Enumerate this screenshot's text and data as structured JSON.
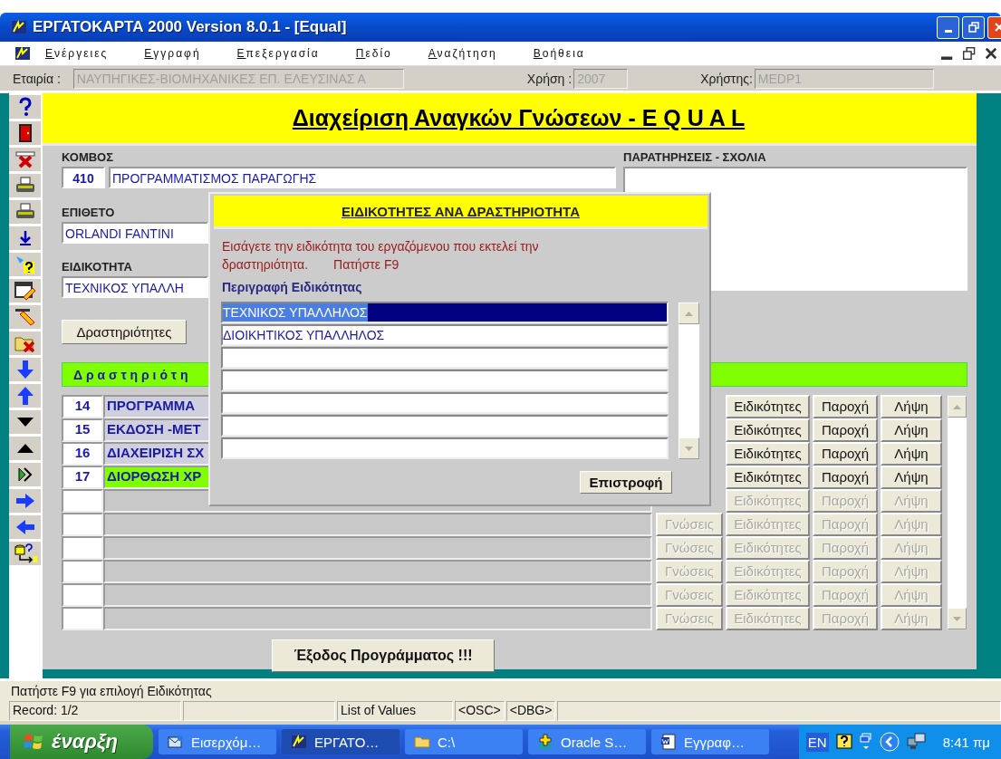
{
  "window": {
    "title": "ΕΡΓΑΤΟΚΑΡΤΑ 2000 Version 8.0.1 - [Equal]"
  },
  "menu": [
    "Ενέργειες",
    "Εγγραφή",
    "Επεξεργασία",
    "Πεδίο",
    "Αναζήτηση",
    "Βοήθεια"
  ],
  "company_bar": {
    "company_label": "Εταιρία :",
    "company": "ΝΑΥΠΗΓΙΚΕΣ-ΒΙΟΜΗΧΑΝΙΚΕΣ ΕΠ. ΕΛΕΥΣΙΝΑΣ Α",
    "year_label": "Χρήση :",
    "year": "2007",
    "user_label": "Χρήστης:",
    "user": "MEDP1"
  },
  "form": {
    "title": "Διαχείριση Αναγκών Γνώσεων - E Q U A L",
    "node_label": "ΚΟΜΒΟΣ",
    "node_code": "410",
    "node_name": "ΠΡΟΓΡΑΜΜΑΤΙΣΜΟΣ ΠΑΡΑΓΩΓΗΣ",
    "surname_label": "ΕΠΙΘΕΤΟ",
    "surname": "ORLANDI FANTINI",
    "specialty_label": "ΕΙΔΙΚΟΤΗΤΑ",
    "specialty": "ΤΕΧΝΙΚΟΣ ΥΠΑΛΛΗ",
    "remarks_label": "ΠΑΡΑΤΗΡΗΣΕΙΣ - ΣΧΟΛΙΑ",
    "activities_button": "Δραστηριότητες",
    "section_title": "Δ ρ α σ τ η ρ ι ό τ η",
    "rows": [
      {
        "number": "14",
        "description": "ΠΡΟΓΡΑΜΜΑ",
        "selected": false,
        "disabled": false,
        "buttons": [
          "Ειδικότητες",
          "Παροχή",
          "Λήψη"
        ]
      },
      {
        "number": "15",
        "description": "ΕΚΔΟΣΗ -ΜΕΤ",
        "selected": false,
        "disabled": false,
        "buttons": [
          "Ειδικότητες",
          "Παροχή",
          "Λήψη"
        ]
      },
      {
        "number": "16",
        "description": "ΔΙΑΧΕΙΡΙΣΗ ΣΧ",
        "selected": false,
        "disabled": false,
        "buttons": [
          "Ειδικότητες",
          "Παροχή",
          "Λήψη"
        ]
      },
      {
        "number": "17",
        "description": "ΔΙΟΡΘΩΣΗ ΧΡ",
        "selected": true,
        "disabled": false,
        "buttons": [
          "Ειδικότητες",
          "Παροχή",
          "Λήψη"
        ]
      },
      {
        "selected": false,
        "disabled": true,
        "buttons": [
          "Ειδικότητες",
          "Παροχή",
          "Λήψη"
        ]
      },
      {
        "selected": false,
        "disabled": true,
        "knowledge_button": "Γνώσεις",
        "buttons": [
          "Ειδικότητες",
          "Παροχή",
          "Λήψη"
        ]
      },
      {
        "selected": false,
        "disabled": true,
        "knowledge_button": "Γνώσεις",
        "buttons": [
          "Ειδικότητες",
          "Παροχή",
          "Λήψη"
        ]
      },
      {
        "selected": false,
        "disabled": true,
        "knowledge_button": "Γνώσεις",
        "buttons": [
          "Ειδικότητες",
          "Παροχή",
          "Λήψη"
        ]
      },
      {
        "selected": false,
        "disabled": true,
        "knowledge_button": "Γνώσεις",
        "buttons": [
          "Ειδικότητες",
          "Παροχή",
          "Λήψη"
        ]
      },
      {
        "selected": false,
        "disabled": true,
        "knowledge_button": "Γνώσεις",
        "buttons": [
          "Ειδικότητες",
          "Παροχή",
          "Λήψη"
        ]
      }
    ],
    "exit_button": "Έξοδος Προγράμματος !!!"
  },
  "dialog": {
    "title": "ΕΙΔΙΚΟΤΗΤΕΣ ΑΝΑ ΔΡΑΣΤΗΡΙΟΤΗΤΑ",
    "message": "Εισάγετε την ειδικότητα του εργαζόμενου που εκτελεί την δραστηριότητα.",
    "hint": "Πατήστε F9",
    "column_header": "Περιγραφή Ειδικότητας",
    "items": [
      {
        "label": "ΤΕΧΝΙΚΟΣ ΥΠΑΛΛΗΛΟΣ",
        "selected": true
      },
      {
        "label": "ΔΙΟΙΚΗΤΙΚΟΣ ΥΠΑΛΛΗΛΟΣ",
        "selected": false
      },
      {
        "selected": false
      },
      {
        "selected": false
      },
      {
        "selected": false
      },
      {
        "selected": false
      },
      {
        "selected": false
      }
    ],
    "return_button": "Επιστροφή"
  },
  "status_bar": {
    "message": "Πατήστε F9 για επιλογή Ειδικότητας",
    "record": "Record: 1/2",
    "mode": "List of Values",
    "osc": "<OSC>",
    "dbg": "<DBG>"
  },
  "taskbar": {
    "start": "έναρξη",
    "tasks": [
      {
        "label": "Εισερχόμ…",
        "selected": false
      },
      {
        "label": "ΕΡΓΑΤΟ…",
        "selected": true
      },
      {
        "label": "C:\\",
        "selected": false
      },
      {
        "label": "Oracle S…",
        "selected": false
      },
      {
        "label": "Εγγραφ…",
        "selected": false
      }
    ],
    "language": "EN",
    "clock": "8:41 πμ"
  }
}
